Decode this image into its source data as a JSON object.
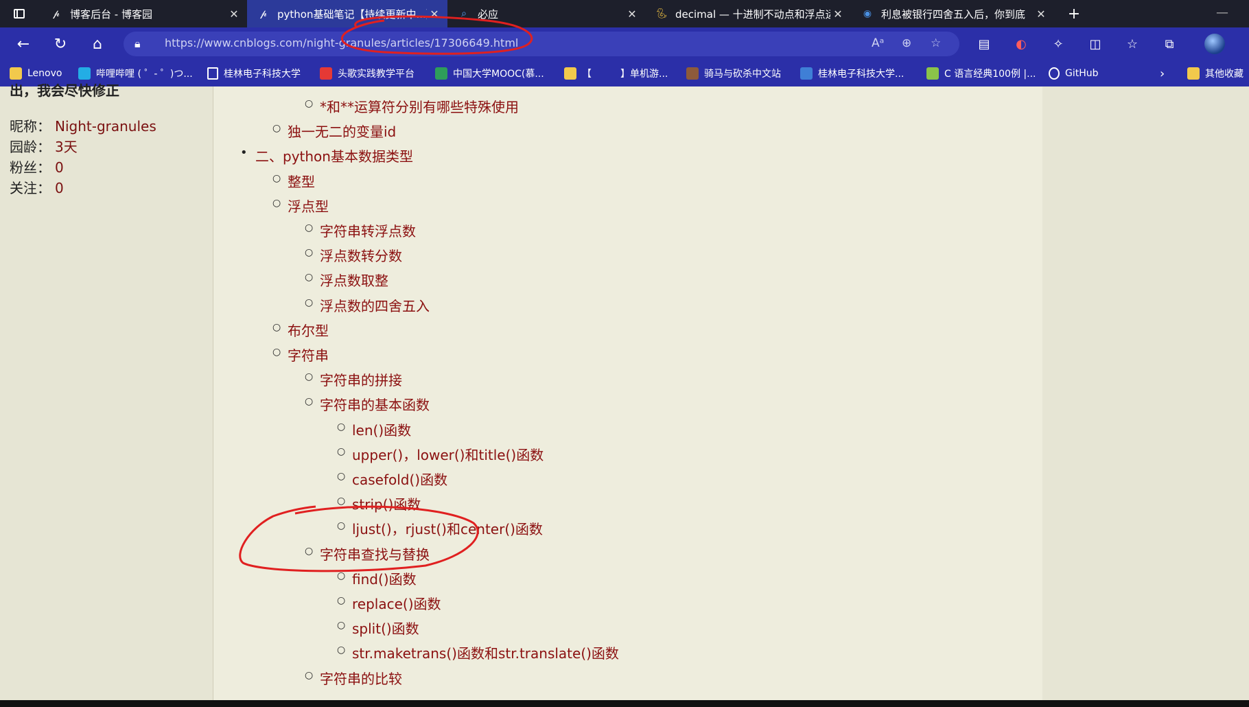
{
  "tabs": [
    {
      "label": "博客后台 - 博客园",
      "icon": "cnblogs-icon",
      "active": false
    },
    {
      "label": "python基础笔记【持续更新中...】",
      "icon": "cnblogs-icon",
      "active": true
    },
    {
      "label": "必应",
      "icon": "search-icon",
      "active": false
    },
    {
      "label": "decimal — 十进制不动点和浮点运算",
      "icon": "python-icon",
      "active": false
    },
    {
      "label": "利息被银行四舍五入后，你到底",
      "icon": "chrome-icon",
      "active": false
    }
  ],
  "address": {
    "url": "https://www.cnblogs.com/night-granules/articles/17306649.html"
  },
  "bookmarks": [
    {
      "label": "Lenovo",
      "icon": "folder-icon",
      "color": "#f2c94c"
    },
    {
      "label": "哔哩哔哩 ( ゜- ゜)つ...",
      "icon": "bilibili-icon",
      "color": "#23ade5"
    },
    {
      "label": "桂林电子科技大学",
      "icon": "page-icon",
      "color": "#ffffff"
    },
    {
      "label": "头歌实践教学平台",
      "icon": "toutiao-icon",
      "color": "#e53935"
    },
    {
      "label": "中国大学MOOC(慕...",
      "icon": "mooc-icon",
      "color": "#2e9d5a"
    },
    {
      "label": "【　　　】单机游...",
      "icon": "game-icon",
      "color": "#f2c94c"
    },
    {
      "label": "骑马与砍杀中文站",
      "icon": "horse-icon",
      "color": "#8d5a3b"
    },
    {
      "label": "桂林电子科技大学...",
      "icon": "abp-icon",
      "color": "#3f7fd6"
    },
    {
      "label": "C 语言经典100例 |...",
      "icon": "runoob-icon",
      "color": "#8bc34a"
    },
    {
      "label": "GitHub",
      "icon": "github-icon",
      "color": "#ffffff"
    },
    {
      "label": "其他收藏",
      "icon": "folder-icon",
      "color": "#f2c94c"
    }
  ],
  "profile": {
    "cut_text": "出，我会尽快修正",
    "rows": [
      {
        "key": "昵称：",
        "value": "Night-granules"
      },
      {
        "key": "园龄：",
        "value": "3天"
      },
      {
        "key": "粉丝：",
        "value": "0"
      },
      {
        "key": "关注：",
        "value": "0"
      }
    ]
  },
  "toc": [
    {
      "level": 3,
      "text": "*和**运算符分别有哪些特殊使用"
    },
    {
      "level": 2,
      "text": "独一无二的变量id"
    },
    {
      "level": 1,
      "text": "二、python基本数据类型"
    },
    {
      "level": 2,
      "text": "整型"
    },
    {
      "level": 2,
      "text": "浮点型"
    },
    {
      "level": 3,
      "text": "字符串转浮点数"
    },
    {
      "level": 3,
      "text": "浮点数转分数"
    },
    {
      "level": 3,
      "text": "浮点数取整"
    },
    {
      "level": 3,
      "text": "浮点数的四舍五入"
    },
    {
      "level": 2,
      "text": "布尔型"
    },
    {
      "level": 2,
      "text": "字符串"
    },
    {
      "level": 3,
      "text": "字符串的拼接"
    },
    {
      "level": 3,
      "text": "字符串的基本函数"
    },
    {
      "level": 4,
      "text": "len()函数"
    },
    {
      "level": 4,
      "text": "upper()，lower()和title()函数"
    },
    {
      "level": 4,
      "text": "casefold()函数"
    },
    {
      "level": 4,
      "text": "strip()函数"
    },
    {
      "level": 4,
      "text": "ljust()，rjust()和center()函数"
    },
    {
      "level": 3,
      "text": "字符串查找与替换"
    },
    {
      "level": 4,
      "text": "find()函数"
    },
    {
      "level": 4,
      "text": "replace()函数"
    },
    {
      "level": 4,
      "text": "split()函数"
    },
    {
      "level": 4,
      "text": "str.maketrans()函数和str.translate()函数"
    },
    {
      "level": 3,
      "text": "字符串的比较"
    }
  ],
  "colors": {
    "link": "#8b1010",
    "annotation": "#e02020"
  }
}
